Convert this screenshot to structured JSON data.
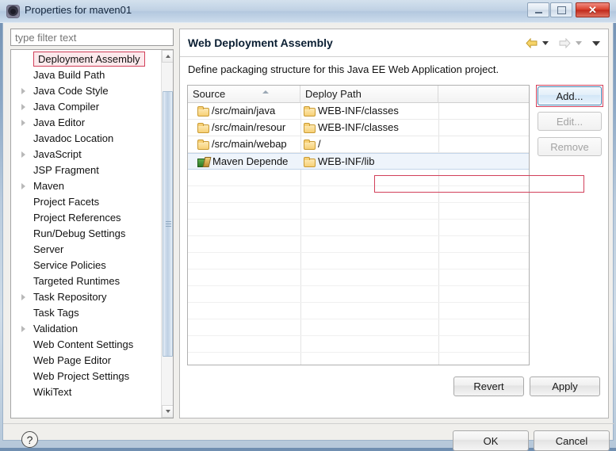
{
  "window": {
    "title": "Properties for maven01",
    "icon": "eclipse-icon",
    "minimize_label": "",
    "maximize_label": "",
    "close_label": "✕"
  },
  "filter": {
    "placeholder": "type filter text",
    "value": ""
  },
  "tree": {
    "selected": "Deployment Assembly",
    "items": [
      {
        "label": "Deployment Assembly",
        "expandable": false,
        "selected": true
      },
      {
        "label": "Java Build Path",
        "expandable": false,
        "selected": false
      },
      {
        "label": "Java Code Style",
        "expandable": true,
        "selected": false
      },
      {
        "label": "Java Compiler",
        "expandable": true,
        "selected": false
      },
      {
        "label": "Java Editor",
        "expandable": true,
        "selected": false
      },
      {
        "label": "Javadoc Location",
        "expandable": false,
        "selected": false
      },
      {
        "label": "JavaScript",
        "expandable": true,
        "selected": false
      },
      {
        "label": "JSP Fragment",
        "expandable": false,
        "selected": false
      },
      {
        "label": "Maven",
        "expandable": true,
        "selected": false
      },
      {
        "label": "Project Facets",
        "expandable": false,
        "selected": false
      },
      {
        "label": "Project References",
        "expandable": false,
        "selected": false
      },
      {
        "label": "Run/Debug Settings",
        "expandable": false,
        "selected": false
      },
      {
        "label": "Server",
        "expandable": false,
        "selected": false
      },
      {
        "label": "Service Policies",
        "expandable": false,
        "selected": false
      },
      {
        "label": "Targeted Runtimes",
        "expandable": false,
        "selected": false
      },
      {
        "label": "Task Repository",
        "expandable": true,
        "selected": false
      },
      {
        "label": "Task Tags",
        "expandable": false,
        "selected": false
      },
      {
        "label": "Validation",
        "expandable": true,
        "selected": false
      },
      {
        "label": "Web Content Settings",
        "expandable": false,
        "selected": false
      },
      {
        "label": "Web Page Editor",
        "expandable": false,
        "selected": false
      },
      {
        "label": "Web Project Settings",
        "expandable": false,
        "selected": false
      },
      {
        "label": "WikiText",
        "expandable": false,
        "selected": false
      }
    ]
  },
  "page": {
    "title": "Web Deployment Assembly",
    "description": "Define packaging structure for this Java EE Web Application project.",
    "nav_back": "back-arrow",
    "nav_forward": "forward-arrow"
  },
  "table": {
    "columns": [
      "Source",
      "Deploy Path",
      ""
    ],
    "sort_column": "Source",
    "sort_direction": "ascending",
    "rows": [
      {
        "source": "/src/main/java",
        "source_icon": "folder-icon",
        "deploy": "WEB-INF/classes",
        "deploy_icon": "folder-icon",
        "selected": false
      },
      {
        "source": "/src/main/resour",
        "source_icon": "folder-icon",
        "deploy": "WEB-INF/classes",
        "deploy_icon": "folder-icon",
        "selected": false
      },
      {
        "source": "/src/main/webap",
        "source_icon": "folder-icon",
        "deploy": "/",
        "deploy_icon": "folder-icon",
        "selected": false
      },
      {
        "source": "Maven Depende",
        "source_icon": "maven-library-icon",
        "deploy": "WEB-INF/lib",
        "deploy_icon": "folder-icon",
        "selected": true
      }
    ],
    "empty_row_count": 12
  },
  "buttons": {
    "add": "Add...",
    "edit": "Edit...",
    "remove": "Remove",
    "revert": "Revert",
    "apply": "Apply",
    "ok": "OK",
    "cancel": "Cancel"
  },
  "button_states": {
    "add": "focused",
    "edit": "disabled",
    "remove": "disabled"
  },
  "footer": {
    "help": "?"
  },
  "colors": {
    "annotation": "#d2405a",
    "focus_border": "#3c7fb1",
    "selection": "#eef4fb",
    "folder": "#f7d075",
    "close_button": "#d9402c"
  }
}
